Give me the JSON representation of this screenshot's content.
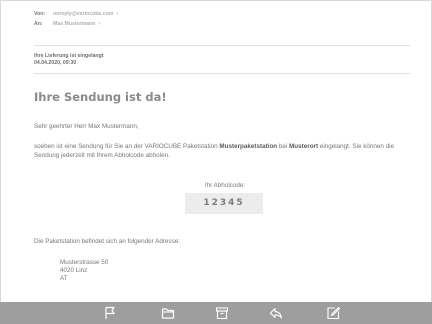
{
  "header": {
    "from_label": "Von:",
    "from_value": "noreply@variocube.com",
    "to_label": "An:",
    "to_value": "Max Mustermann",
    "chevron": "›"
  },
  "meta": {
    "subject": "Ihre Lieferung ist eingelangt",
    "date": "04.04.2020, 09:30"
  },
  "message": {
    "title": "Ihre Sendung ist da!",
    "greeting": "Sehr geehrter Herr Max Mustermann,",
    "body_part1": "soeben ist eine Sendung für Sie an der VARIOCUBE Paketstation ",
    "body_bold1": "Musterpaketstation",
    "body_part2": " bei ",
    "body_bold2": "Musterort",
    "body_part3": " eingelangt. Sie können die Sendung jederzeit mit Ihrem Abholcode abholen.",
    "code_label": "Ihr Abholcode:",
    "code": "12345",
    "address_intro": "Die Paketstation befindet sich an folgender Adresse:",
    "address_line1": "Musterstrasse 50",
    "address_line2": "4020 Linz",
    "address_line3": "AT"
  },
  "toolbar": {
    "icons": [
      "flag-icon",
      "folder-icon",
      "archive-icon",
      "reply-icon",
      "compose-icon"
    ],
    "color": "#9e9e9e"
  }
}
